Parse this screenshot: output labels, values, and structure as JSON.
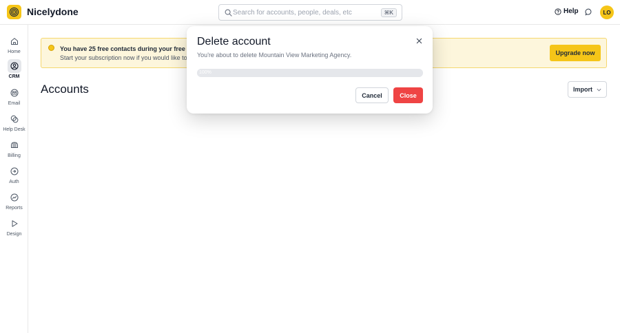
{
  "app": {
    "name": "Nicelydone",
    "brand_color": "#f5c518",
    "logo_icon": "spiral-logo-icon"
  },
  "header": {
    "search": {
      "placeholder": "Search for accounts, people, deals, etc",
      "value": "",
      "shortcut": "⌘K"
    },
    "help_label": "Help",
    "avatar_initials": "LO"
  },
  "sidebar": {
    "items": [
      {
        "label": "Home",
        "icon": "home-icon",
        "active": false
      },
      {
        "label": "CRM",
        "icon": "crm-icon",
        "active": true
      },
      {
        "label": "Email",
        "icon": "email-icon",
        "active": false
      },
      {
        "label": "Help Desk",
        "icon": "help-desk-icon",
        "active": false
      },
      {
        "label": "Billing",
        "icon": "billing-icon",
        "active": false
      },
      {
        "label": "Auth",
        "icon": "auth-icon",
        "active": false
      },
      {
        "label": "Reports",
        "icon": "reports-icon",
        "active": false
      },
      {
        "label": "Design",
        "icon": "design-icon",
        "active": false
      }
    ]
  },
  "banner": {
    "title": "You have 25 free contacts during your free trial",
    "subtitle": "Start your subscription now if you would like to i",
    "cta": "Upgrade now"
  },
  "main": {
    "title": "Accounts",
    "import_label": "Import"
  },
  "modal": {
    "title": "Delete account",
    "description": "You're about to delete Mountain View Marketing Agency.",
    "progress": {
      "label": "100%",
      "fraction": 1.0
    },
    "cancel_label": "Cancel",
    "close_label": "Close",
    "danger_color": "#ef4444"
  }
}
